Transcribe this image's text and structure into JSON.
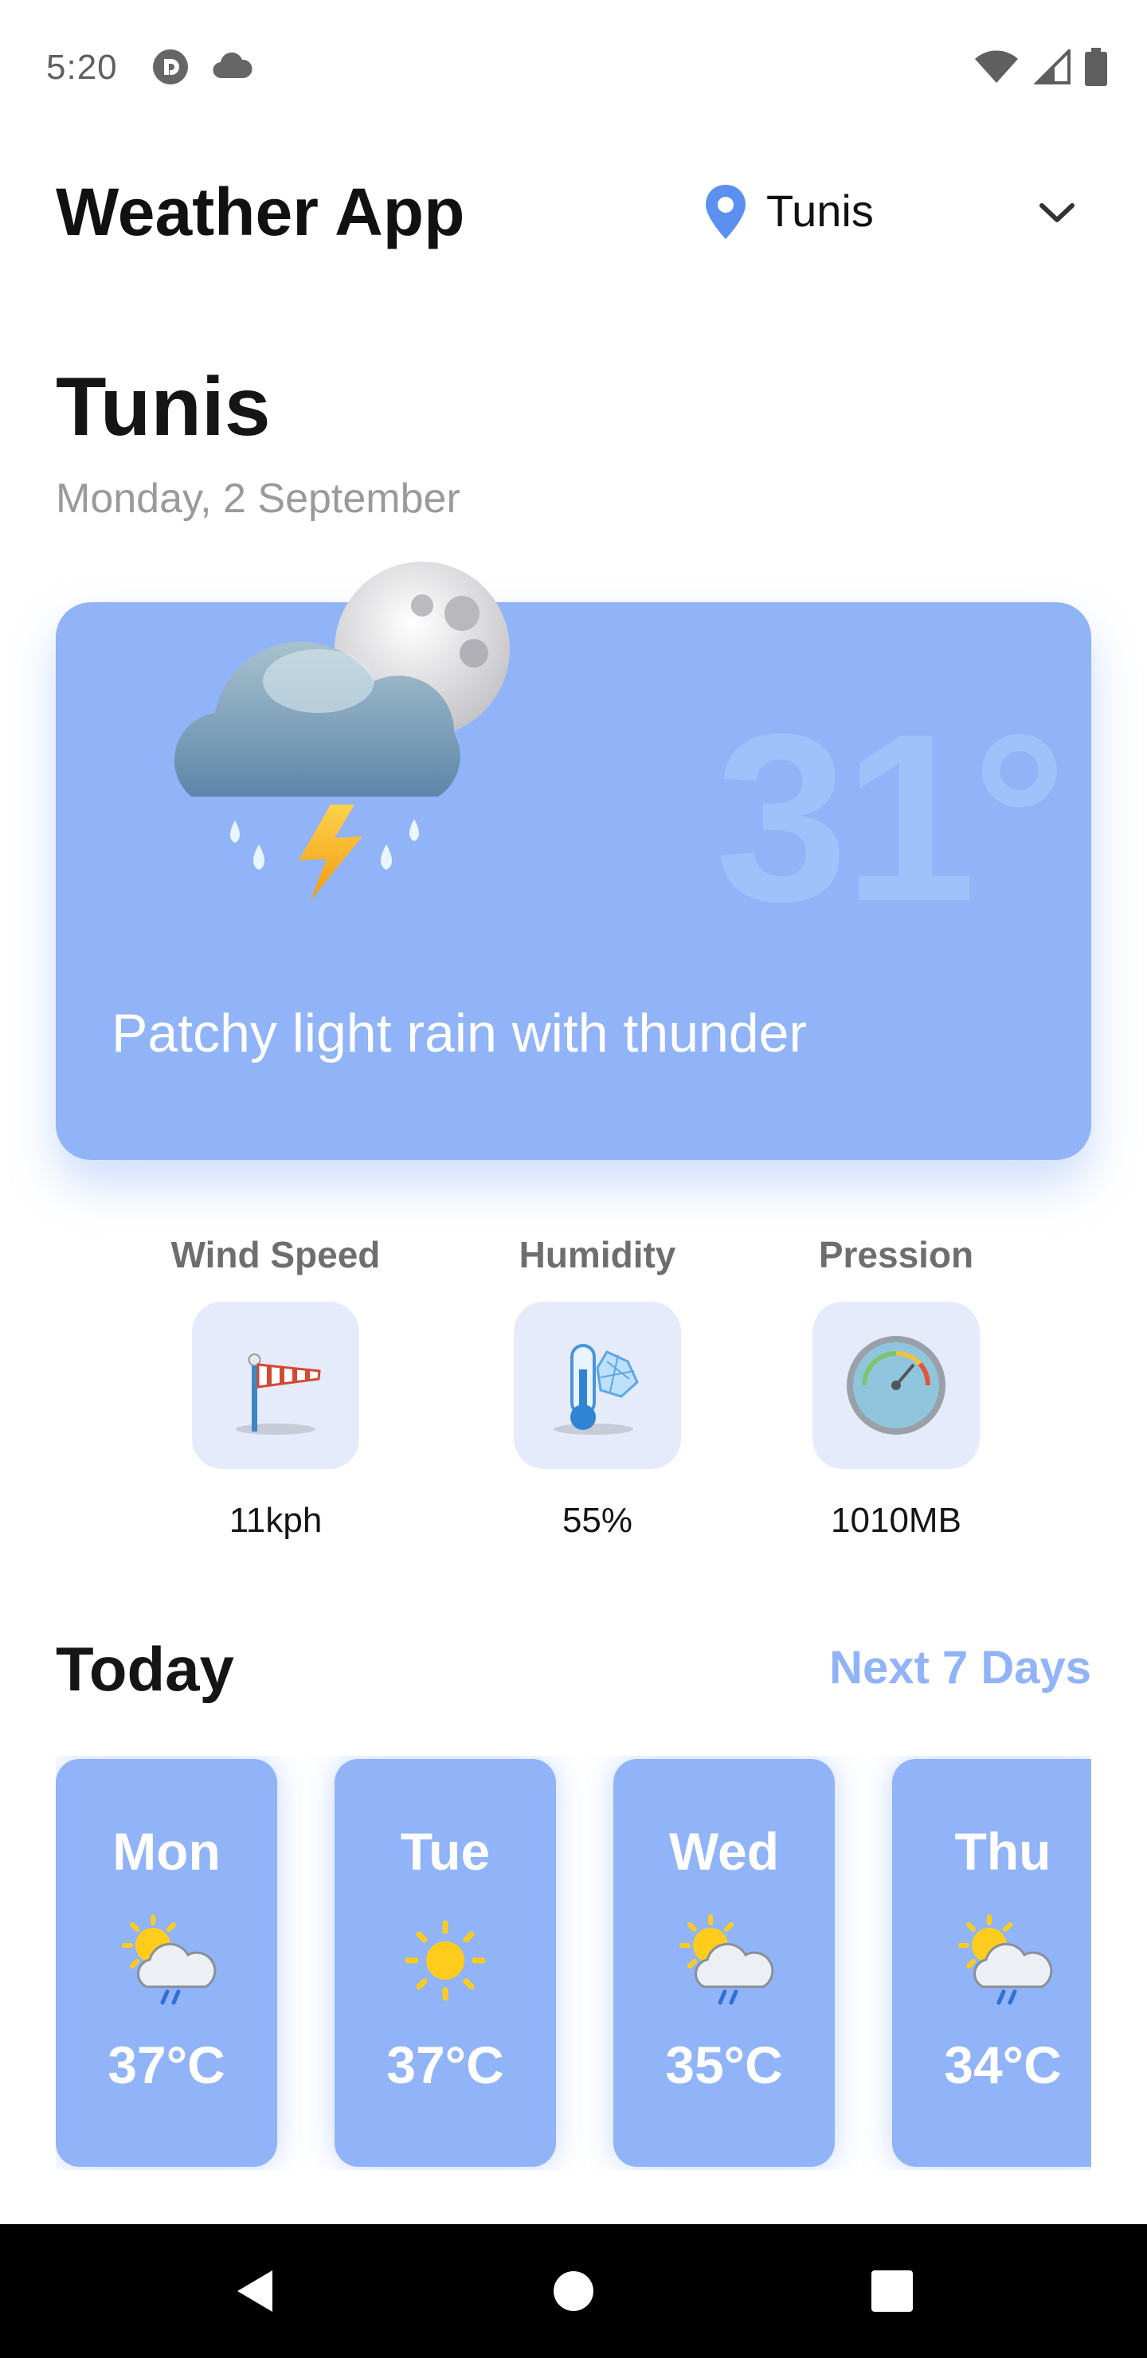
{
  "status_bar": {
    "time": "5:20",
    "icons": [
      "app-notification-icon",
      "cloud-icon",
      "wifi-icon",
      "signal-icon",
      "battery-icon"
    ]
  },
  "header": {
    "title": "Weather App",
    "location_selector": {
      "value": "Tunis",
      "icon": "location-pin-icon"
    }
  },
  "city": {
    "name": "Tunis",
    "date": "Monday, 2 September"
  },
  "current": {
    "temperature": "31°",
    "condition": "Patchy light rain with thunder",
    "icon": "thunder-rain-night-icon"
  },
  "stats": [
    {
      "label": "Wind Speed",
      "value": "11kph",
      "icon": "windsock-icon"
    },
    {
      "label": "Humidity",
      "value": "55%",
      "icon": "thermometer-icon"
    },
    {
      "label": "Pression",
      "value": "1010MB",
      "icon": "barometer-icon"
    }
  ],
  "today": {
    "title": "Today",
    "link": "Next 7 Days",
    "days": [
      {
        "day": "Mon",
        "temp": "37°C",
        "icon": "sun-cloud-rain-icon"
      },
      {
        "day": "Tue",
        "temp": "37°C",
        "icon": "sun-icon"
      },
      {
        "day": "Wed",
        "temp": "35°C",
        "icon": "sun-cloud-rain-icon"
      },
      {
        "day": "Thu",
        "temp": "34°C",
        "icon": "sun-cloud-rain-icon"
      }
    ]
  },
  "colors": {
    "accent": "#91b3f7",
    "stat_box": "#e5ebfb",
    "muted_text": "#9a9a9a",
    "nav_bar": "#000000"
  }
}
